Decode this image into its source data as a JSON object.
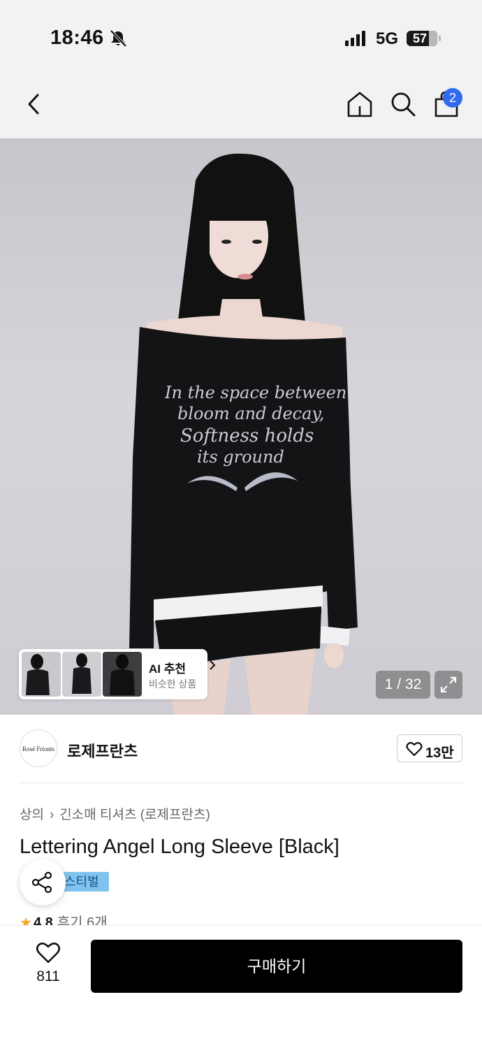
{
  "status_bar": {
    "time": "18:46",
    "network": "5G",
    "battery": "57",
    "icons": [
      "bell-off-icon",
      "signal-icon",
      "battery-icon"
    ]
  },
  "nav": {
    "cart_count": "2",
    "icons": [
      "back-arrow-icon",
      "home-icon",
      "search-icon",
      "shopping-bag-icon"
    ]
  },
  "gallery": {
    "image_text": [
      "In the space between",
      "bloom and decay,",
      "Softness holds",
      "its ground"
    ],
    "counter": "1 / 32",
    "ai_card": {
      "title": "AI 추천",
      "subtitle": "비슷한 상품"
    }
  },
  "brand": {
    "logo_text": "Rosé Frionts",
    "name": "로제프란츠",
    "likes": "13만"
  },
  "product": {
    "breadcrumb": [
      "상의",
      "긴소매 티셔츠 (로제프란츠)"
    ],
    "title": "Lettering Angel Long Sleeve [Black]",
    "tag": "스티벌",
    "rating": "4.8",
    "reviews": "후기 6개"
  },
  "bottom": {
    "wishlist_count": "811",
    "buy_label": "구매하기"
  },
  "colors": {
    "accent_badge": "#2f6bf0",
    "star": "#f5a623",
    "buy_button": "#000000",
    "tag_bg": "#7fc4ee"
  }
}
